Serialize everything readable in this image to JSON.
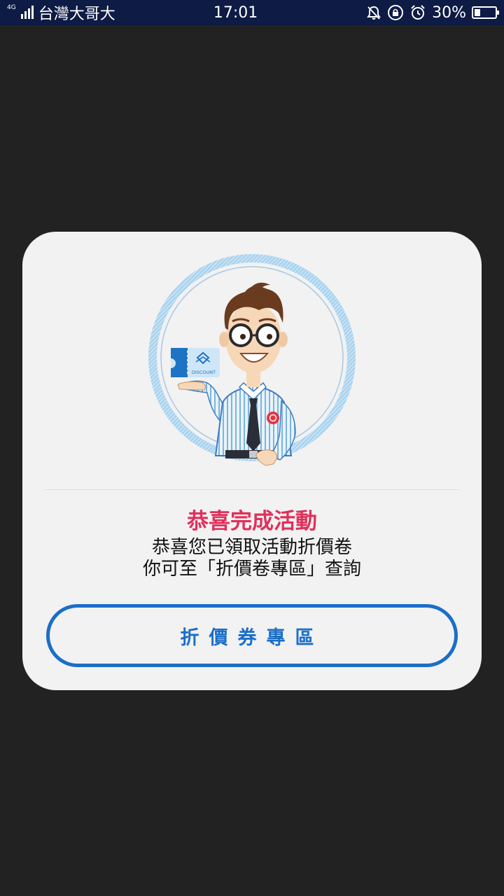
{
  "status_bar": {
    "network": "4G",
    "carrier": "台灣大哥大",
    "time": "17:01",
    "battery_percent": "30%",
    "battery_level": 0.3,
    "icons": [
      "signal-icon",
      "mute-bell-icon",
      "rotation-lock-icon",
      "alarm-icon",
      "battery-icon"
    ]
  },
  "dialog": {
    "illustration": {
      "ticket_text": "DISCOUNT"
    },
    "title": "恭喜完成活動",
    "message_line1": "恭喜您已領取活動折價卷",
    "message_line2": "你可至「折價卷專區」查詢",
    "button_label": "折價券專區"
  },
  "colors": {
    "title": "#e0305a",
    "accent": "#1a6ec8",
    "dialog_bg": "#f2f2f2",
    "overlay_bg": "#222222",
    "status_bar_bg": "#0d1b45"
  }
}
